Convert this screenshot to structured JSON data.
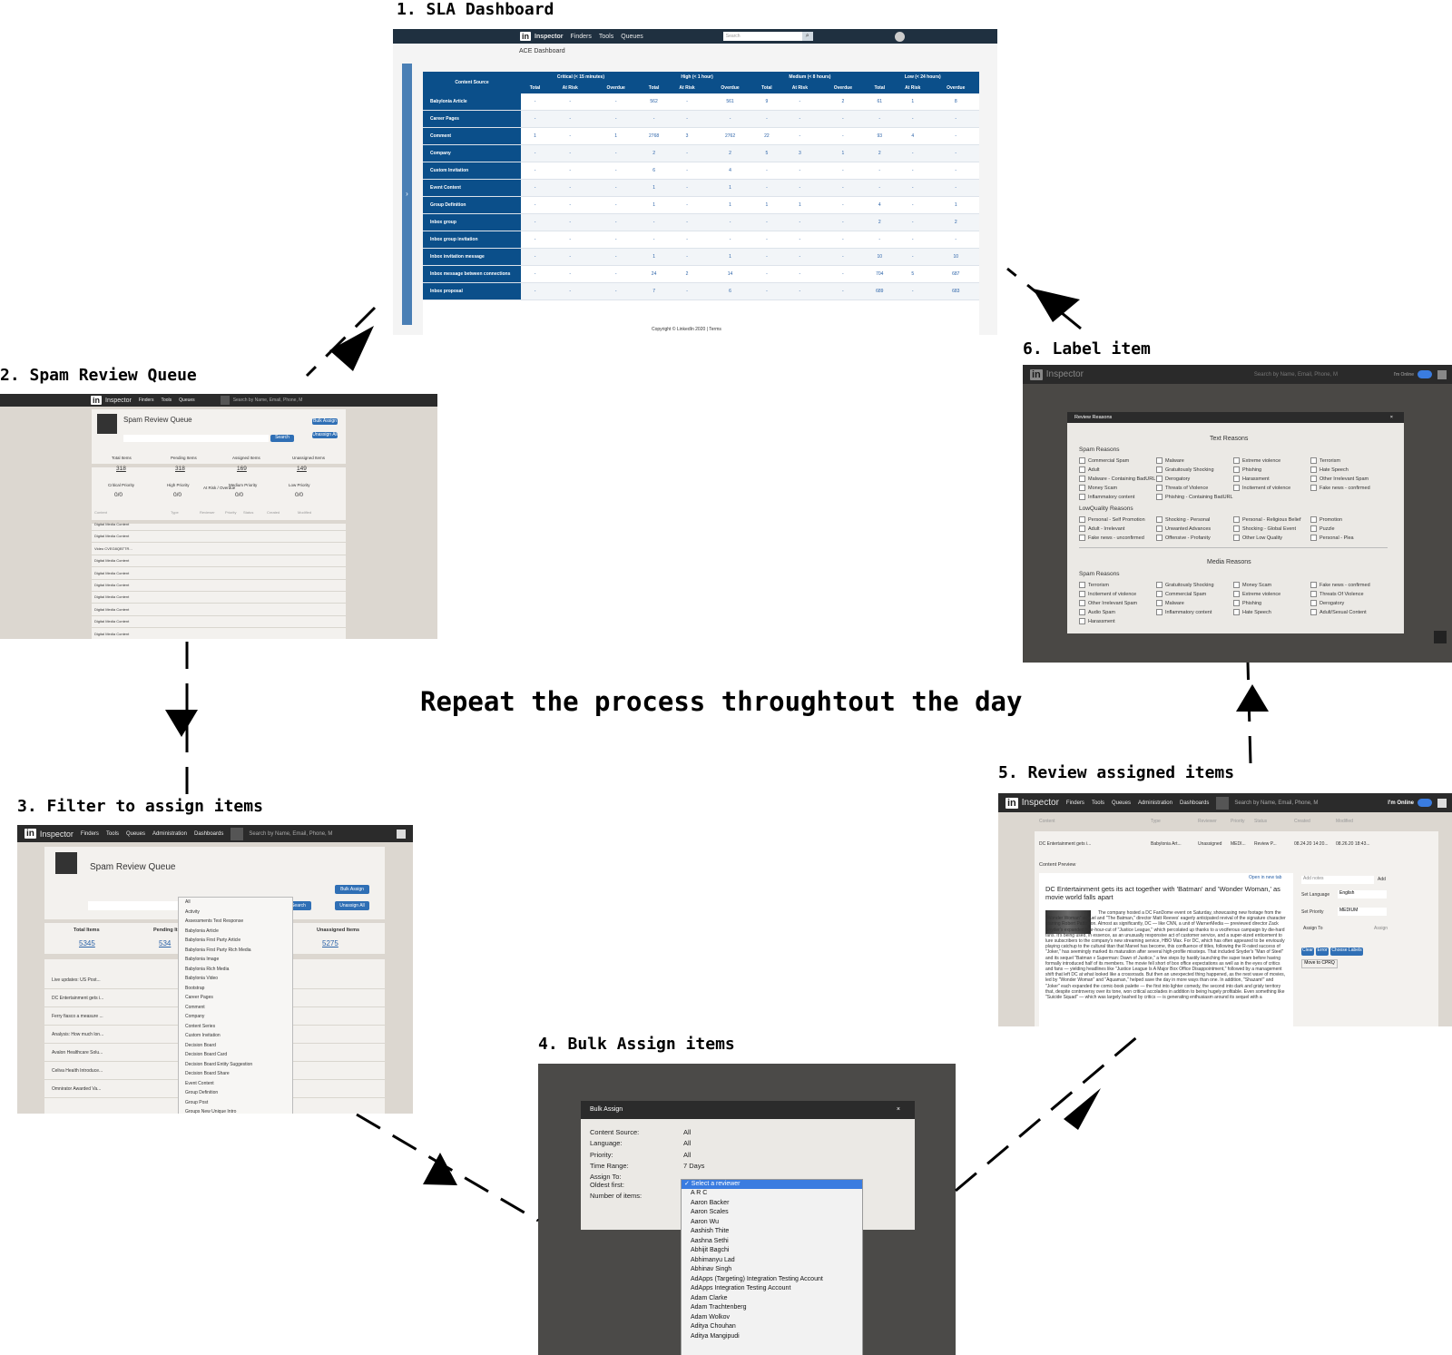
{
  "caption": "Repeat the process throughtout the day",
  "steps": [
    {
      "title": "1. SLA Dashboard"
    },
    {
      "title": "2. Spam Review Queue"
    },
    {
      "title": "3. Filter to assign items"
    },
    {
      "title": "4. Bulk Assign items"
    },
    {
      "title": "5. Review assigned items"
    },
    {
      "title": "6. Label item"
    }
  ],
  "app": {
    "brand": "Inspector",
    "nav": [
      "Finders",
      "Tools",
      "Queues",
      "Administration",
      "Dashboards"
    ],
    "search_placeholder": "Search by Name, Email, Phone, M",
    "status": "I'm Online"
  },
  "sla": {
    "search_placeholder": "Search",
    "page_title": "ACE Dashboard",
    "groups": [
      "Critical (< 15 minutes)",
      "High (< 1 hour)",
      "Medium (< 8 hours)",
      "Low (< 24 hours)"
    ],
    "source_header": "Content Source",
    "subheaders": [
      "Total",
      "At Risk",
      "Overdue"
    ],
    "rows": [
      {
        "src": "Babylonia Article",
        "v": [
          "-",
          "-",
          "-",
          "562",
          "-",
          "561",
          "9",
          "-",
          "2",
          "61",
          "1",
          "8"
        ]
      },
      {
        "src": "Career Pages",
        "v": [
          "-",
          "-",
          "-",
          "-",
          "-",
          "-",
          "-",
          "-",
          "-",
          "-",
          "-",
          "-"
        ]
      },
      {
        "src": "Comment",
        "v": [
          "1",
          "-",
          "1",
          "2768",
          "3",
          "2762",
          "22",
          "-",
          "-",
          "93",
          "4",
          "-"
        ]
      },
      {
        "src": "Company",
        "v": [
          "-",
          "-",
          "-",
          "2",
          "-",
          "2",
          "5",
          "3",
          "1",
          "2",
          "-",
          "-"
        ]
      },
      {
        "src": "Custom Invitation",
        "v": [
          "-",
          "-",
          "-",
          "6",
          "-",
          "4",
          "-",
          "-",
          "-",
          "-",
          "-",
          "-"
        ]
      },
      {
        "src": "Event Content",
        "v": [
          "-",
          "-",
          "-",
          "1",
          "-",
          "1",
          "-",
          "-",
          "-",
          "-",
          "-",
          "-"
        ]
      },
      {
        "src": "Group Definition",
        "v": [
          "-",
          "-",
          "-",
          "1",
          "-",
          "1",
          "1",
          "1",
          "-",
          "4",
          "-",
          "1"
        ]
      },
      {
        "src": "Inbox group",
        "v": [
          "-",
          "-",
          "-",
          "-",
          "-",
          "-",
          "-",
          "-",
          "-",
          "2",
          "-",
          "2"
        ]
      },
      {
        "src": "Inbox group invitation",
        "v": [
          "-",
          "-",
          "-",
          "-",
          "-",
          "-",
          "-",
          "-",
          "-",
          "-",
          "-",
          "-"
        ]
      },
      {
        "src": "Inbox invitation message",
        "v": [
          "-",
          "-",
          "-",
          "1",
          "-",
          "1",
          "-",
          "-",
          "-",
          "10",
          "-",
          "10"
        ]
      },
      {
        "src": "Inbox message between connections",
        "v": [
          "-",
          "-",
          "-",
          "24",
          "2",
          "14",
          "-",
          "-",
          "-",
          "704",
          "5",
          "687"
        ]
      },
      {
        "src": "Inbox proposal",
        "v": [
          "-",
          "-",
          "-",
          "7",
          "-",
          "6",
          "-",
          "-",
          "-",
          "689",
          "-",
          "683"
        ]
      }
    ],
    "footer": "Copyright © LinkedIn 2020 | Terms"
  },
  "queue": {
    "title": "Spam Review Queue",
    "bulk_assign": "Bulk Assign",
    "unassign_all": "Unassign All",
    "search_btn": "Search",
    "stats_labels": [
      "Total Items",
      "Pending Items",
      "Assigned Items",
      "Unassigned Items"
    ],
    "stats_values": [
      "318",
      "318",
      "169",
      "149"
    ],
    "priority_labels": [
      "Critical Priority",
      "High Priority",
      "Medium Priority",
      "Low Priority"
    ],
    "priority_values": [
      "0/0",
      "0/0",
      "0/0",
      "0/0"
    ],
    "risk_label": "At Risk / Overdue",
    "columns": [
      "Content",
      "Type",
      "Reviewer",
      "Priority",
      "Status",
      "Created",
      "Modified"
    ],
    "rows": [
      "Digital Media Content",
      "Digital Media Content",
      "Video CVEG8QBTTR...",
      "Digital Media Content",
      "Digital Media Content",
      "Digital Media Content",
      "Digital Media Content",
      "Digital Media Content",
      "Digital Media Content",
      "Digital Media Content"
    ]
  },
  "filter": {
    "title": "Spam Review Queue",
    "stats_labels": [
      "Total Items",
      "Pending It",
      "Unassigned Items"
    ],
    "stats_values": [
      "5345",
      "534",
      "5275"
    ],
    "dropdown": [
      "All",
      "Activity",
      "Assessments Test Response",
      "Babylonia Article",
      "Babylonia First Party Article",
      "Babylonia First Party Rich Media",
      "Babylonia Image",
      "Babylonia Rich Media",
      "Babylonia Video",
      "Bootstrap",
      "Career Pages",
      "Comment",
      "Company",
      "Content Series",
      "Custom Invitation",
      "Decision Board",
      "Decision Board Card",
      "Decision Board Entity Suggestion",
      "Decision Board Share",
      "Event Content",
      "Group Definition",
      "Group Post",
      "Groups New Unique Intro"
    ],
    "rows": [
      "Live updates: US Post...",
      "DC Entertainment gets i...",
      "Ferry fiasco a measure ...",
      "Analysis: How much lon...",
      "Avalon Healthcare Solu...",
      "Celiva Health Introduce...",
      "Omnirator Awarded Va..."
    ]
  },
  "bulk": {
    "dialog_title": "Bulk Assign",
    "fields": [
      {
        "label": "Content Source:",
        "value": "All"
      },
      {
        "label": "Language:",
        "value": "All"
      },
      {
        "label": "Priority:",
        "value": "All"
      },
      {
        "label": "Time Range:",
        "value": "7 Days"
      },
      {
        "label": "Assign To:",
        "value": ""
      },
      {
        "label": "Oldest first:",
        "value": ""
      },
      {
        "label": "Number of items:",
        "value": ""
      }
    ],
    "selected": "✓ Select a reviewer",
    "reviewers": [
      "A R C",
      "Aaron Backer",
      "Aaron Scales",
      "Aaron Wu",
      "Aashish Thite",
      "Aashna Sethi",
      "Abhijit Bagchi",
      "Abhimanyu Lad",
      "Abhinav Singh",
      "AdApps (Targeting) Integration Testing Account",
      "AdApps Integration Testing Account",
      "Adam Clarke",
      "Adam Trachtenberg",
      "Adam Wolkov",
      "Aditya Chouhan",
      "Aditya Mangipudi"
    ]
  },
  "review": {
    "columns": [
      "Content",
      "Type",
      "Reviewer",
      "Priority",
      "Status",
      "Created",
      "Modified"
    ],
    "row": [
      "DC Entertainment gets i...",
      "Babylonia Art...",
      "Unassigned",
      "MEDI...",
      "Review P...",
      "08.24.20 14:20...",
      "08.26.20 18:43..."
    ],
    "preview_label": "Content Preview",
    "open_tab": "Open in new tab",
    "headline": "DC Entertainment gets its act together with 'Batman' and 'Wonder Woman,' as movie world falls apart",
    "body": "The company hosted a DC FanDome event on Saturday, showcasing new footage from the \"Wonder Woman\" sequel and \"The Batman,\" director Matt Reeves' eagerly anticipated revival of the signature character starring Robert Pattinson. Almost as significantly, DC — like CNN, a unit of WarnerMedia — previewed director Zack Snyder's expanded four-hour-cut of \"Justice League,\" which percolated up thanks to a vociferous campaign by die-hard fans. It's being used, in essence, as an unusually responsive act of customer service, and a super-sized enticement to lure subscribers to the company's new streaming service, HBO Max. For DC, which has often appeared to be enviously playing catchup to the cultural titan that Marvel has become, this confluence of titles, following the R-rated success of \"Joker,\" has seemingly marked its maturation after several high-profile missteps. That included Snyder's \"Man of Steel\" and its sequel \"Batman v Superman: Dawn of Justice,\" a few steps by hastily launching the super team before having formally introduced half of its members. The movie fell short of box office expectations as well as in the eyes of critics and fans — yielding headlines like \"Justice League Is A Major Box Office Disappointment,\" followed by a management shift that left DC at what looked like a crossroads. But then an unexpected thing happened, as the next wave of movies, led by \"Wonder Woman\" and \"Aquaman,\" helped save the day in more ways than one. In addition, \"Shazam!\" and \"Joker\" each expanded the comic-book palette — the first into lighter comedy, the second into dark and grisly territory that, despite controversy over its tone, won critical accolades in addition to being hugely profitable. Even something like \"Suicide Squad\" — which was largely bashed by critics — is generating enthusiasm around its sequel with a",
    "add_notes": "Add notes",
    "add": "Add",
    "set_language": "Set Language",
    "language": "English",
    "set_priority": "Set Priority",
    "priority": "MEDIUM",
    "assign_to": "Assign To",
    "assign": "Assign",
    "buttons": [
      "Clear",
      "Error",
      "Choose Labels"
    ],
    "move": "Move to CPRQ"
  },
  "label": {
    "dialog_title": "Review Reasons",
    "text_reasons": "Text Reasons",
    "spam_reasons": "Spam Reasons",
    "lowquality": "LowQuality Reasons",
    "media_reasons": "Media Reasons",
    "spam_items": [
      "Commercial Spam",
      "Malware",
      "Extreme violence",
      "Terrorism",
      "Adult",
      "Gratuitously Shocking",
      "Phishing",
      "Hate Speech",
      "Malware - Containing BadURL",
      "Derogatory",
      "Harassment",
      "Other Irrelevant Spam",
      "Money Scam",
      "Threats of Violence",
      "Incitement of violence",
      "Fake news - confirmed",
      "Inflammatory content",
      "Phishing - Containing BadURL"
    ],
    "lq_items": [
      "Personal - Self Promotion",
      "Shocking - Personal",
      "Personal - Religious Belief",
      "Promotion",
      "Adult - Irrelevant",
      "Unwanted Advances",
      "Shocking - Global Event",
      "Puzzle",
      "Fake news - unconfirmed",
      "Offensive - Profanity",
      "Other Low Quality",
      "Personal - Plea"
    ],
    "media_items": [
      "Terrorism",
      "Gratuitously Shocking",
      "Money Scam",
      "Fake news - confirmed",
      "Incitement of violence",
      "Commercial Spam",
      "Extreme violence",
      "Threats Of Violence",
      "Other Irrelevant Spam",
      "Malware",
      "Phishing",
      "Derogatory",
      "Audio Spam",
      "Inflammatory content",
      "Hate Speech",
      "Adult/Sexual Content",
      "Harassment"
    ]
  }
}
